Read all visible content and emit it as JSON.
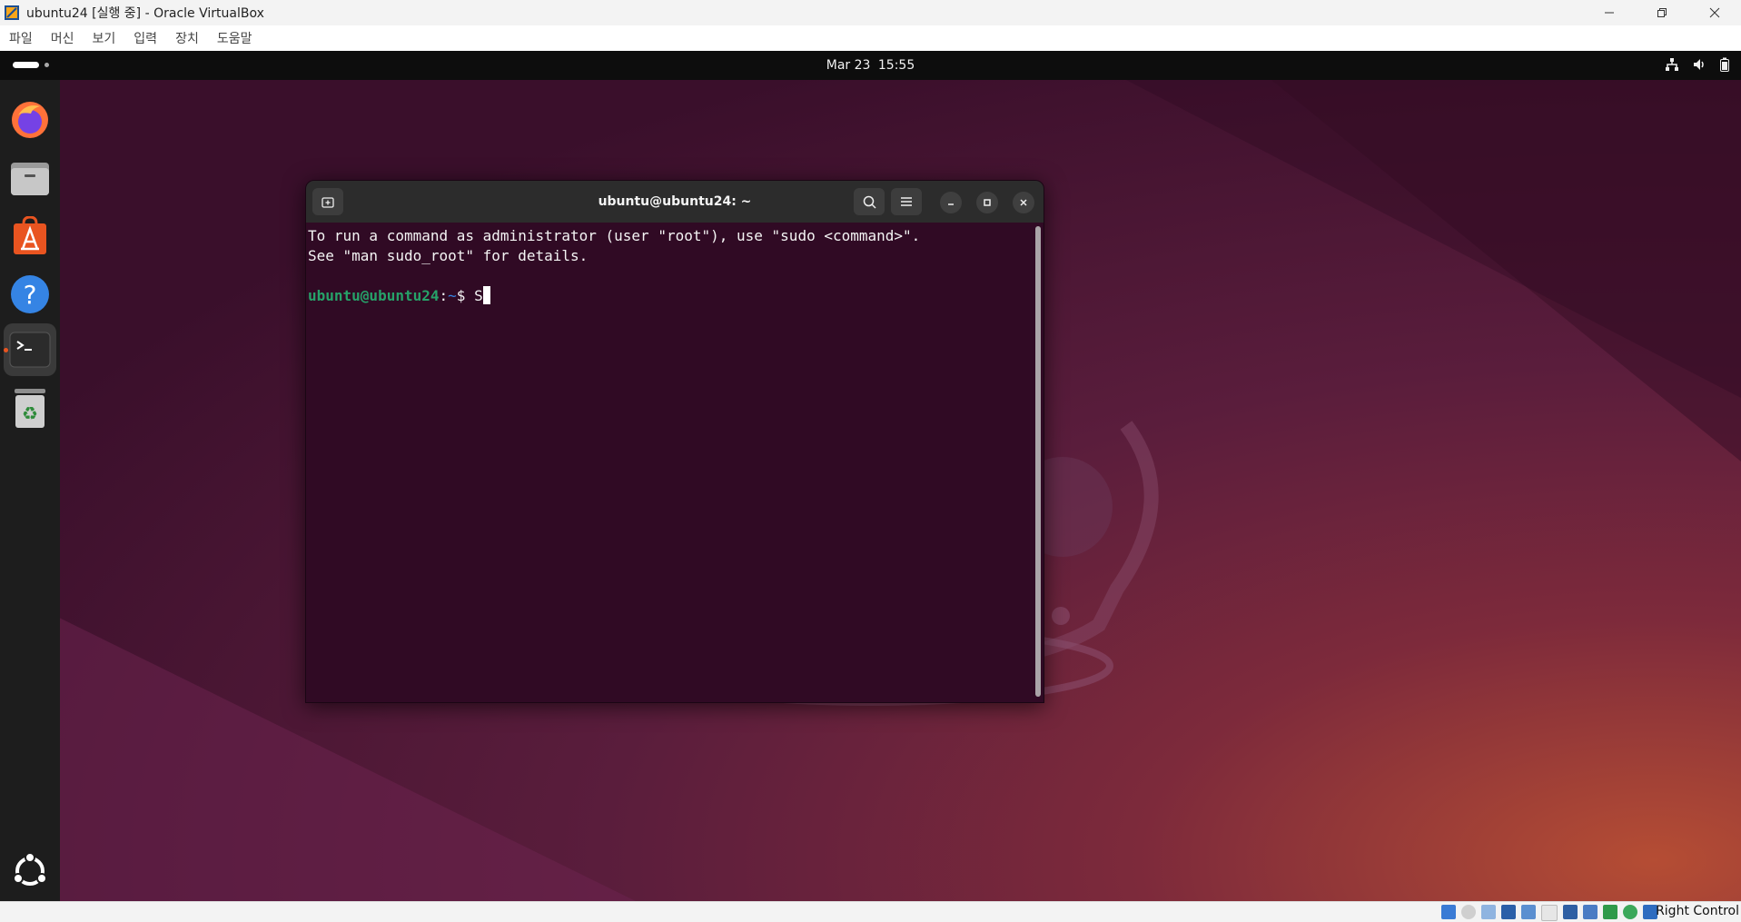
{
  "window": {
    "title": "ubuntu24 [실행 중] - Oracle VirtualBox",
    "controls": [
      "minimize",
      "restore",
      "close"
    ]
  },
  "vbox_menu": {
    "items": [
      {
        "label": "파일"
      },
      {
        "label": "머신"
      },
      {
        "label": "보기"
      },
      {
        "label": "입력"
      },
      {
        "label": "장치"
      },
      {
        "label": "도움말"
      }
    ]
  },
  "gnome_topbar": {
    "date": "Mar 23",
    "time": "15:55",
    "tray_icons": [
      "network-icon",
      "volume-icon",
      "battery-icon"
    ]
  },
  "dock": {
    "items": [
      {
        "icon": "firefox-icon",
        "active": false
      },
      {
        "icon": "files-icon",
        "active": false
      },
      {
        "icon": "app-center-icon",
        "active": false
      },
      {
        "icon": "help-icon",
        "active": false
      },
      {
        "icon": "terminal-icon",
        "active": true
      },
      {
        "icon": "trash-icon",
        "active": false
      }
    ],
    "show_apps_icon": "ubuntu-apps-icon"
  },
  "terminal": {
    "title": "ubuntu@ubuntu24: ~",
    "lines": [
      "To run a command as administrator (user \"root\"), use \"sudo <command>\".",
      "See \"man sudo_root\" for details."
    ],
    "prompt": {
      "user_host": "ubuntu@ubuntu24",
      "separator": ":",
      "path": "~",
      "symbol": "$",
      "input": "S"
    }
  },
  "statusbar": {
    "host_key": "Right Control"
  },
  "colors": {
    "terminal_bg": "#300a24",
    "prompt_user": "#26a269",
    "prompt_path": "#3584e4",
    "dock_bg": "#1d1d1d",
    "accent": "#e95420"
  }
}
